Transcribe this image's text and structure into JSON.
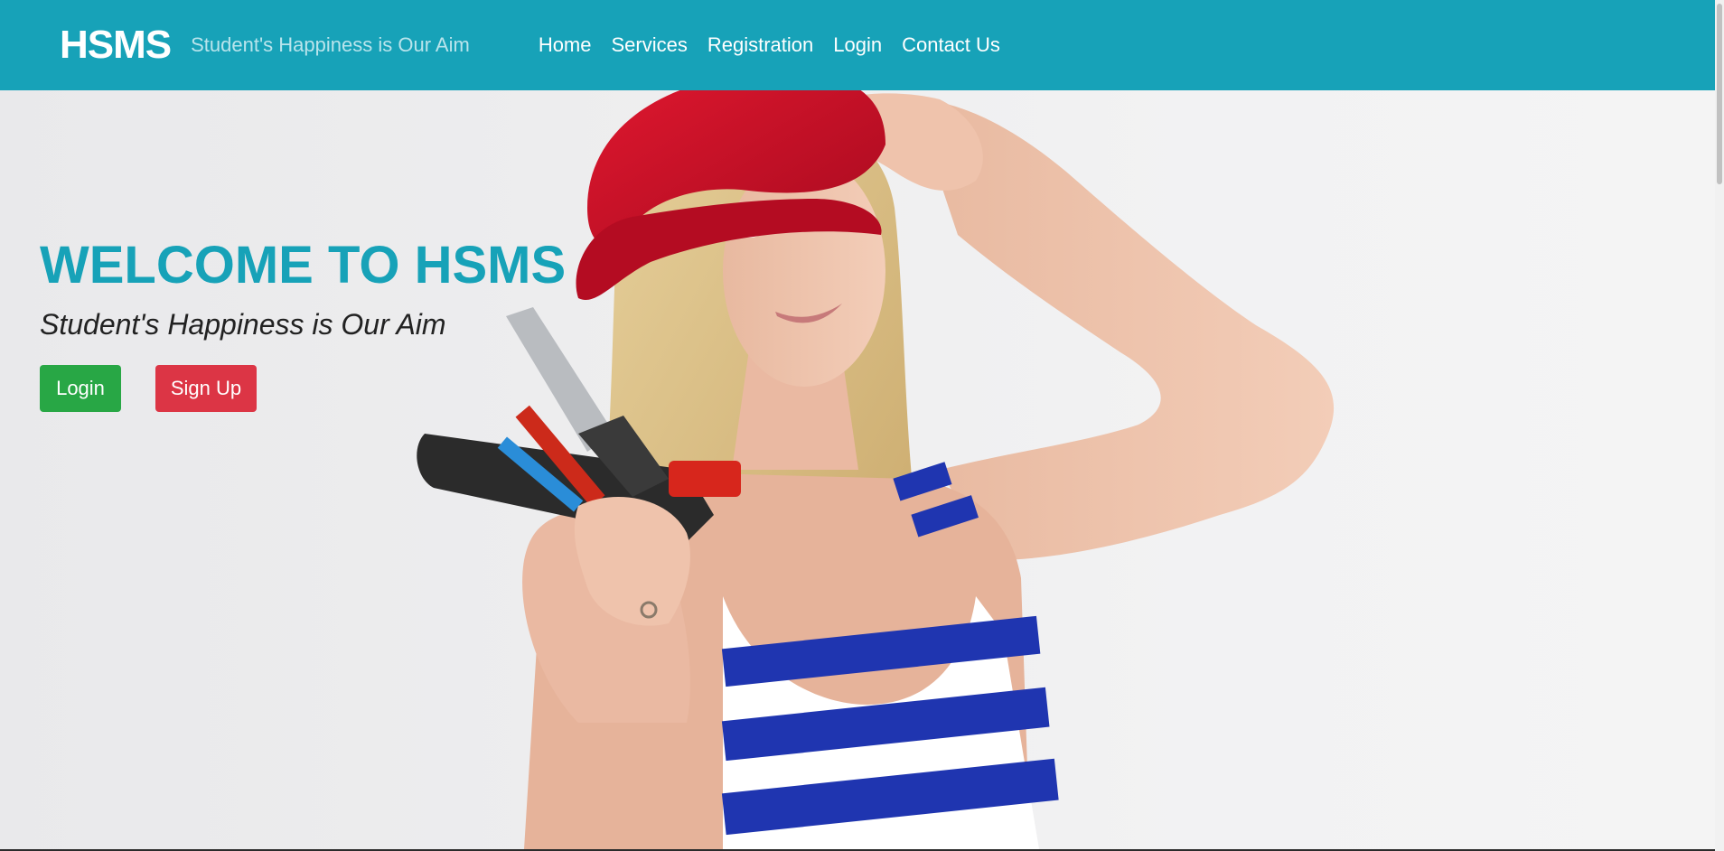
{
  "navbar": {
    "brand": "HSMS",
    "tagline": "Student's Happiness is Our Aim",
    "links": [
      "Home",
      "Services",
      "Registration",
      "Login",
      "Contact Us"
    ]
  },
  "hero": {
    "title": "WELCOME TO HSMS",
    "subtitle": "Student's Happiness is Our Aim",
    "login_label": "Login",
    "signup_label": "Sign Up"
  },
  "colors": {
    "navbar_bg": "#17a2b8",
    "title": "#17a2b8",
    "login_button": "#28a745",
    "signup_button": "#dc3545",
    "helmet": "#c8102e",
    "shirt_stripe": "#1f35b0"
  },
  "hero_image": {
    "description_icon": "worker-with-tools-photo"
  }
}
